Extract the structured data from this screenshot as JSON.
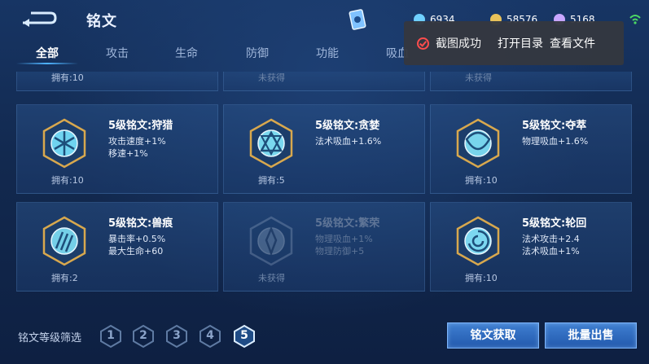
{
  "header": {
    "title": "铭文",
    "currencies": [
      {
        "icon": "diamond-icon",
        "value": "6934",
        "color": "#6fd0ff"
      },
      {
        "icon": "gold-coin-icon",
        "value": "58576",
        "color": "#e8c25a"
      },
      {
        "icon": "purple-orb-icon",
        "value": "5168",
        "color": "#c9a6ff"
      }
    ]
  },
  "tabs": [
    "全部",
    "攻击",
    "生命",
    "防御",
    "功能",
    "吸血"
  ],
  "active_tab": "全部",
  "toast": {
    "message": "截图成功",
    "open_folder": "打开目录",
    "view_file": "查看文件"
  },
  "top_row": [
    {
      "owned_text": "拥有:10"
    },
    {
      "owned_text": "未获得"
    },
    {
      "owned_text": "未获得"
    }
  ],
  "runes": [
    {
      "name": "5级铭文:狩猎",
      "attrs": [
        "攻击速度+1%",
        "移速+1%"
      ],
      "owned_text": "拥有:10",
      "locked": false
    },
    {
      "name": "5级铭文:贪婪",
      "attrs": [
        "法术吸血+1.6%"
      ],
      "owned_text": "拥有:5",
      "locked": false
    },
    {
      "name": "5级铭文:夺萃",
      "attrs": [
        "物理吸血+1.6%"
      ],
      "owned_text": "拥有:10",
      "locked": false
    },
    {
      "name": "5级铭文:兽痕",
      "attrs": [
        "暴击率+0.5%",
        "最大生命+60"
      ],
      "owned_text": "拥有:2",
      "locked": false
    },
    {
      "name": "5级铭文:繁荣",
      "attrs": [
        "物理吸血+1%",
        "物理防御+5"
      ],
      "owned_text": "未获得",
      "locked": true
    },
    {
      "name": "5级铭文:轮回",
      "attrs": [
        "法术攻击+2.4",
        "法术吸血+1%"
      ],
      "owned_text": "拥有:10",
      "locked": false
    }
  ],
  "footer": {
    "filter_label": "铭文等级筛选",
    "levels": [
      "1",
      "2",
      "3",
      "4",
      "5"
    ],
    "active_level": "5",
    "get_button": "铭文获取",
    "sell_button": "批量出售"
  }
}
